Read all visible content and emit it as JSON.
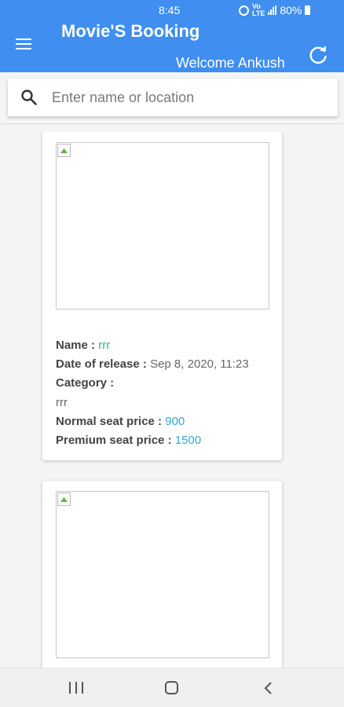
{
  "status_bar": {
    "time": "8:45",
    "battery": "80%",
    "network": "VoLTE"
  },
  "app_bar": {
    "title": "Movie'S Booking",
    "welcome": "Welcome Ankush",
    "menu_icon": "menu-icon",
    "refresh_icon": "refresh-icon",
    "color": "#3f8ef0"
  },
  "search": {
    "placeholder": "Enter name or location",
    "value": "",
    "icon": "search-icon"
  },
  "movies": [
    {
      "name_label": "Name :",
      "name": "rrr",
      "release_label": "Date of release :",
      "release": "Sep 8, 2020, 11:23",
      "category_label": "Category :",
      "category": "rrr",
      "normal_label": "Normal seat price :",
      "normal_price": "900",
      "premium_label": "Premium seat price :",
      "premium_price": "1500"
    }
  ],
  "colors": {
    "name_value": "#2db87a",
    "price_value": "#32a8dc"
  },
  "nav_bar": {
    "recents_icon": "recents-icon",
    "home_icon": "home-icon",
    "back_icon": "back-icon"
  }
}
